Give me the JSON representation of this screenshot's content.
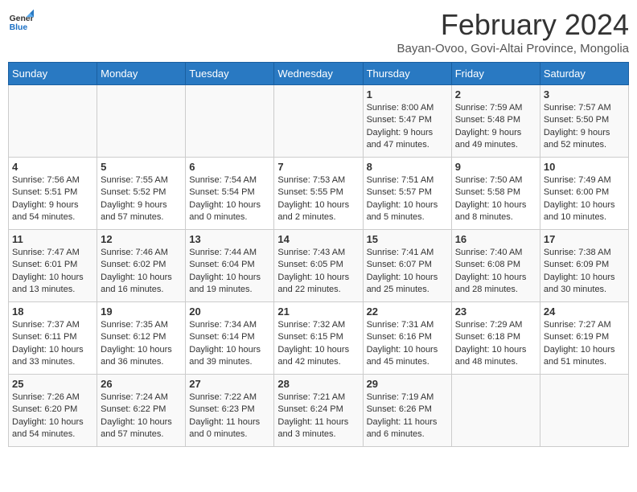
{
  "header": {
    "logo_line1": "General",
    "logo_line2": "Blue",
    "title": "February 2024",
    "subtitle": "Bayan-Ovoo, Govi-Altai Province, Mongolia"
  },
  "days_of_week": [
    "Sunday",
    "Monday",
    "Tuesday",
    "Wednesday",
    "Thursday",
    "Friday",
    "Saturday"
  ],
  "weeks": [
    [
      {
        "day": "",
        "info": ""
      },
      {
        "day": "",
        "info": ""
      },
      {
        "day": "",
        "info": ""
      },
      {
        "day": "",
        "info": ""
      },
      {
        "day": "1",
        "info": "Sunrise: 8:00 AM\nSunset: 5:47 PM\nDaylight: 9 hours and 47 minutes."
      },
      {
        "day": "2",
        "info": "Sunrise: 7:59 AM\nSunset: 5:48 PM\nDaylight: 9 hours and 49 minutes."
      },
      {
        "day": "3",
        "info": "Sunrise: 7:57 AM\nSunset: 5:50 PM\nDaylight: 9 hours and 52 minutes."
      }
    ],
    [
      {
        "day": "4",
        "info": "Sunrise: 7:56 AM\nSunset: 5:51 PM\nDaylight: 9 hours and 54 minutes."
      },
      {
        "day": "5",
        "info": "Sunrise: 7:55 AM\nSunset: 5:52 PM\nDaylight: 9 hours and 57 minutes."
      },
      {
        "day": "6",
        "info": "Sunrise: 7:54 AM\nSunset: 5:54 PM\nDaylight: 10 hours and 0 minutes."
      },
      {
        "day": "7",
        "info": "Sunrise: 7:53 AM\nSunset: 5:55 PM\nDaylight: 10 hours and 2 minutes."
      },
      {
        "day": "8",
        "info": "Sunrise: 7:51 AM\nSunset: 5:57 PM\nDaylight: 10 hours and 5 minutes."
      },
      {
        "day": "9",
        "info": "Sunrise: 7:50 AM\nSunset: 5:58 PM\nDaylight: 10 hours and 8 minutes."
      },
      {
        "day": "10",
        "info": "Sunrise: 7:49 AM\nSunset: 6:00 PM\nDaylight: 10 hours and 10 minutes."
      }
    ],
    [
      {
        "day": "11",
        "info": "Sunrise: 7:47 AM\nSunset: 6:01 PM\nDaylight: 10 hours and 13 minutes."
      },
      {
        "day": "12",
        "info": "Sunrise: 7:46 AM\nSunset: 6:02 PM\nDaylight: 10 hours and 16 minutes."
      },
      {
        "day": "13",
        "info": "Sunrise: 7:44 AM\nSunset: 6:04 PM\nDaylight: 10 hours and 19 minutes."
      },
      {
        "day": "14",
        "info": "Sunrise: 7:43 AM\nSunset: 6:05 PM\nDaylight: 10 hours and 22 minutes."
      },
      {
        "day": "15",
        "info": "Sunrise: 7:41 AM\nSunset: 6:07 PM\nDaylight: 10 hours and 25 minutes."
      },
      {
        "day": "16",
        "info": "Sunrise: 7:40 AM\nSunset: 6:08 PM\nDaylight: 10 hours and 28 minutes."
      },
      {
        "day": "17",
        "info": "Sunrise: 7:38 AM\nSunset: 6:09 PM\nDaylight: 10 hours and 30 minutes."
      }
    ],
    [
      {
        "day": "18",
        "info": "Sunrise: 7:37 AM\nSunset: 6:11 PM\nDaylight: 10 hours and 33 minutes."
      },
      {
        "day": "19",
        "info": "Sunrise: 7:35 AM\nSunset: 6:12 PM\nDaylight: 10 hours and 36 minutes."
      },
      {
        "day": "20",
        "info": "Sunrise: 7:34 AM\nSunset: 6:14 PM\nDaylight: 10 hours and 39 minutes."
      },
      {
        "day": "21",
        "info": "Sunrise: 7:32 AM\nSunset: 6:15 PM\nDaylight: 10 hours and 42 minutes."
      },
      {
        "day": "22",
        "info": "Sunrise: 7:31 AM\nSunset: 6:16 PM\nDaylight: 10 hours and 45 minutes."
      },
      {
        "day": "23",
        "info": "Sunrise: 7:29 AM\nSunset: 6:18 PM\nDaylight: 10 hours and 48 minutes."
      },
      {
        "day": "24",
        "info": "Sunrise: 7:27 AM\nSunset: 6:19 PM\nDaylight: 10 hours and 51 minutes."
      }
    ],
    [
      {
        "day": "25",
        "info": "Sunrise: 7:26 AM\nSunset: 6:20 PM\nDaylight: 10 hours and 54 minutes."
      },
      {
        "day": "26",
        "info": "Sunrise: 7:24 AM\nSunset: 6:22 PM\nDaylight: 10 hours and 57 minutes."
      },
      {
        "day": "27",
        "info": "Sunrise: 7:22 AM\nSunset: 6:23 PM\nDaylight: 11 hours and 0 minutes."
      },
      {
        "day": "28",
        "info": "Sunrise: 7:21 AM\nSunset: 6:24 PM\nDaylight: 11 hours and 3 minutes."
      },
      {
        "day": "29",
        "info": "Sunrise: 7:19 AM\nSunset: 6:26 PM\nDaylight: 11 hours and 6 minutes."
      },
      {
        "day": "",
        "info": ""
      },
      {
        "day": "",
        "info": ""
      }
    ]
  ]
}
